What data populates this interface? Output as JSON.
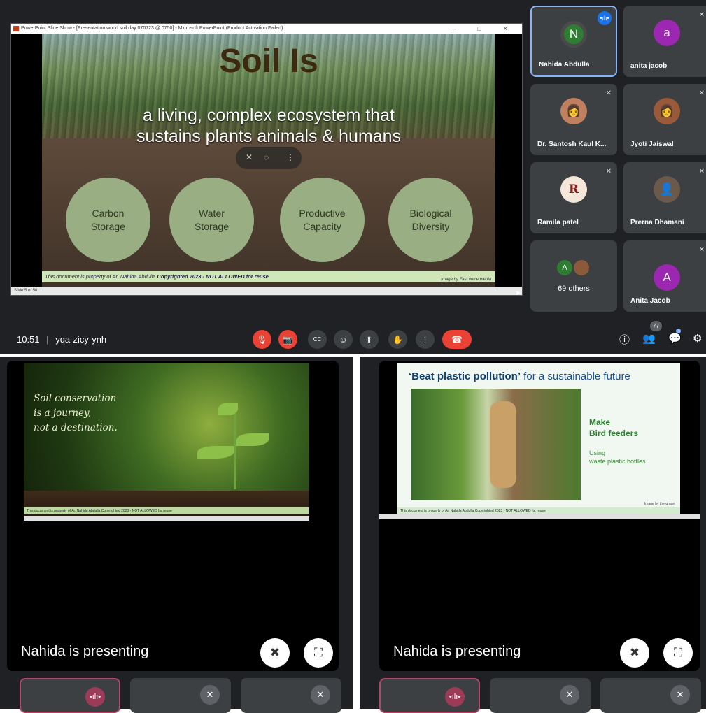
{
  "window_title": "PowerPoint Slide Show - [Presentation world soil day 070723 @ 0750] - Microsoft PowerPoint (Product Activation Failed)",
  "window_controls": "– □ ✕",
  "slide": {
    "title": "Soil Is",
    "subtitle_line1": "a living, complex ecosystem that",
    "subtitle_line2": "sustains plants animals & humans",
    "circles": [
      {
        "l1": "Carbon",
        "l2": "Storage"
      },
      {
        "l1": "Water",
        "l2": "Storage"
      },
      {
        "l1": "Productive",
        "l2": "Capacity"
      },
      {
        "l1": "Biological",
        "l2": "Diversity"
      }
    ],
    "copyright_prefix": "This document is property of Ar. Nahida Abdulla ",
    "copyright_bold": "Copyrighted 2023 - NOT ALLOWED for reuse",
    "image_credit": "Image by Fast voice media",
    "status": "Slide 5 of 50"
  },
  "participants": [
    {
      "name": "Nahida Abdulla",
      "initial": "N",
      "color": "#2e7d32",
      "speaking": true
    },
    {
      "name": "anita jacob",
      "initial": "a",
      "color": "#9c27b0",
      "speaking": false
    },
    {
      "name": "Dr. Santosh Kaul K...",
      "initial": "",
      "color": "#c08060",
      "speaking": false
    },
    {
      "name": "Jyoti Jaiswal",
      "initial": "",
      "color": "#9a5a3a",
      "speaking": false
    },
    {
      "name": "Ramila patel",
      "initial": "R",
      "color": "#f4e6d8",
      "speaking": false
    },
    {
      "name": "Prerna Dhamani",
      "initial": "",
      "color": "#6b5a4a",
      "speaking": false
    },
    {
      "name": "69 others",
      "initial": "A",
      "color": "#2e7d32",
      "speaking": false
    },
    {
      "name": "Anita Jacob",
      "initial": "A",
      "color": "#9c27b0",
      "speaking": false
    }
  ],
  "toolbar": {
    "time": "10:51",
    "separator": "|",
    "meeting_code": "yqa-zicy-ynh",
    "people_count": "77"
  },
  "panel1": {
    "quote_line1": "Soil conservation",
    "quote_line2": "is a journey,",
    "quote_line3": "not a destination.",
    "copyright": "This document is property of Ar. Nahida Abdulla Copyrighted 2023 - NOT ALLOWED for reuse",
    "presenting": "Nahida is presenting"
  },
  "panel2": {
    "title_bold": "‘Beat plastic pollution’",
    "title_rest": " for a sustainable future",
    "make1": "Make",
    "make2": "Bird feeders",
    "using1": "Using",
    "using2": "waste plastic bottles",
    "copyright": "This document is property of Ar. Nahida Abdulla Copyrighted 2023 - NOT ALLOWED for reuse",
    "credit": "Image by the-grace",
    "presenting": "Nahida is presenting"
  },
  "icons": {
    "mic_off": "🎙",
    "cam_off": "📷",
    "captions": "CC",
    "emoji": "☺",
    "present": "⬆",
    "hand": "✋",
    "more": "⋮",
    "end_call": "☎",
    "info": "ⓘ",
    "people": "👥",
    "chat": "💬",
    "activities": "⚙",
    "unpin": "✖",
    "fullscreen": "⛶",
    "speaking": "•ılı•",
    "muted": "✕"
  }
}
